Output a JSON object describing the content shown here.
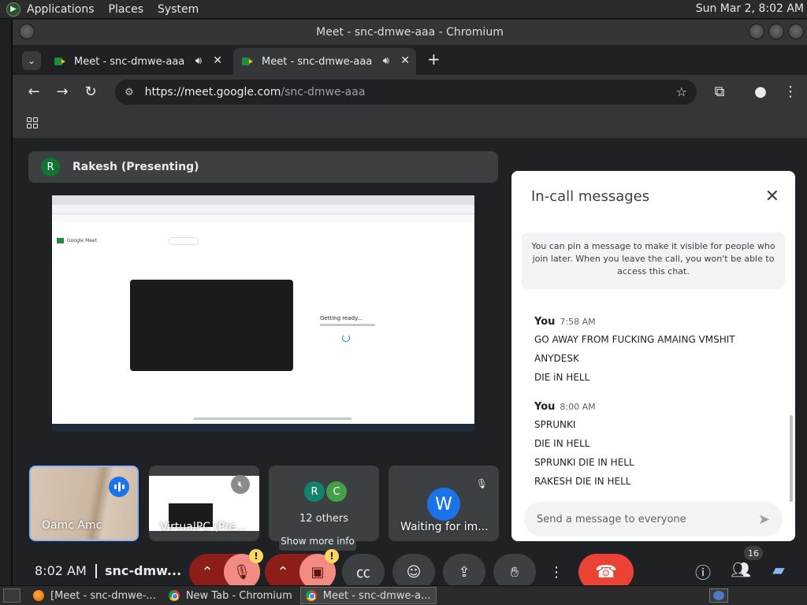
{
  "desktop": {
    "menus": [
      "Applications",
      "Places",
      "System"
    ],
    "clock": "Sun Mar 2,  8:02 AM"
  },
  "window": {
    "title": "Meet - snc-dmwe-aaa - Chromium"
  },
  "browser": {
    "tabs": [
      {
        "title": "Meet - snc-dmwe-aaa",
        "active": false
      },
      {
        "title": "Meet - snc-dmwe-aaa",
        "active": true
      }
    ],
    "url_host": "https://meet.google.com",
    "url_path": "/snc-dmwe-aaa"
  },
  "meet": {
    "presenter": {
      "initial": "R",
      "label": "Rakesh (Presenting)"
    },
    "shared_screen": {
      "status": "Getting ready..."
    },
    "tiles": [
      {
        "name": "Oamc Amc",
        "state": "speaking"
      },
      {
        "name": "VirtualPC (Pre...",
        "state": "muted"
      },
      {
        "label": "12 others",
        "avatars": [
          "R",
          "C"
        ]
      },
      {
        "name": "Waiting for im...",
        "initial": "W",
        "state": "muted"
      }
    ],
    "tooltip": "Show more info",
    "time": "8:02 AM",
    "meeting_code": "snc-dmw...",
    "participant_count": "16",
    "colors": {
      "end_call": "#ea4335",
      "mic_off": "#f28b82",
      "accent": "#8ab4f8"
    }
  },
  "chat": {
    "title": "In-call messages",
    "notice": "You can pin a message to make it visible for people who join later. When you leave the call, you won't be able to access this chat.",
    "groups": [
      {
        "sender": "You",
        "time": "7:58 AM",
        "messages": [
          "GO AWAY FROM FUCKING AMAING VMSHIT",
          "ANYDESK",
          "DIE iN HELL"
        ]
      },
      {
        "sender": "You",
        "time": "8:00 AM",
        "messages": [
          "SPRUNKI",
          "DIE IN HELL",
          "SPRUNKI DIE IN HELL",
          "RAKESH DIE IN HELL"
        ]
      }
    ],
    "input_placeholder": "Send a message to everyone"
  },
  "taskbar": {
    "tasks": [
      {
        "label": "[Meet - snc-dmwe-...",
        "icon": "firefox-icon"
      },
      {
        "label": "New Tab - Chromium",
        "icon": "chromium-icon"
      },
      {
        "label": "Meet - snc-dmwe-a...",
        "icon": "chromium-icon",
        "active": true
      }
    ]
  }
}
